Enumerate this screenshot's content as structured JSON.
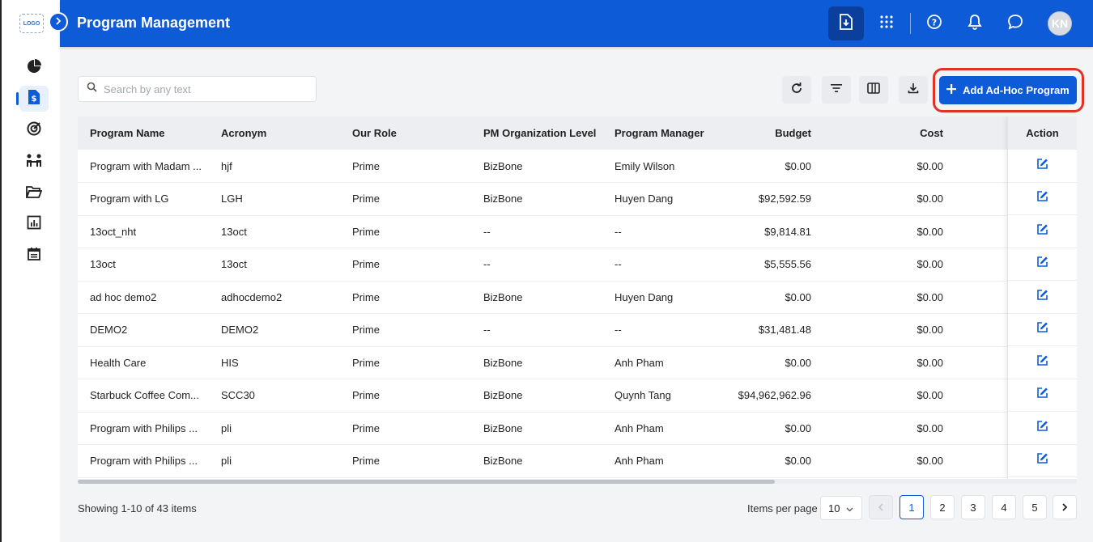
{
  "sidebar": {
    "logo_text": "LOGO",
    "items": [
      {
        "icon": "pie-chart-icon"
      },
      {
        "icon": "dollar-document-icon",
        "active": true
      },
      {
        "icon": "target-icon"
      },
      {
        "icon": "people-icon"
      },
      {
        "icon": "folder-open-icon"
      },
      {
        "icon": "bar-chart-icon"
      },
      {
        "icon": "calendar-icon"
      }
    ]
  },
  "header": {
    "title": "Program Management",
    "avatar_initials": "KN"
  },
  "search": {
    "placeholder": "Search by any text"
  },
  "toolbar": {
    "add_label": "Add Ad-Hoc Program"
  },
  "table": {
    "columns": [
      "Program Name",
      "Acronym",
      "Our Role",
      "PM Organization Level",
      "Program Manager",
      "Budget",
      "Cost"
    ],
    "action_header": "Action",
    "rows": [
      {
        "name": "Program with Madam ...",
        "acronym": "hjf",
        "role": "Prime",
        "level": "BizBone",
        "manager": "Emily Wilson",
        "budget": "$0.00",
        "cost": "$0.00"
      },
      {
        "name": "Program with LG",
        "acronym": "LGH",
        "role": "Prime",
        "level": "BizBone",
        "manager": "Huyen Dang",
        "budget": "$92,592.59",
        "cost": "$0.00"
      },
      {
        "name": "13oct_nht",
        "acronym": "13oct",
        "role": "Prime",
        "level": "--",
        "manager": "--",
        "budget": "$9,814.81",
        "cost": "$0.00"
      },
      {
        "name": "13oct",
        "acronym": "13oct",
        "role": "Prime",
        "level": "--",
        "manager": "--",
        "budget": "$5,555.56",
        "cost": "$0.00"
      },
      {
        "name": "ad hoc demo2",
        "acronym": "adhocdemo2",
        "role": "Prime",
        "level": "BizBone",
        "manager": "Huyen Dang",
        "budget": "$0.00",
        "cost": "$0.00"
      },
      {
        "name": "DEMO2",
        "acronym": "DEMO2",
        "role": "Prime",
        "level": "--",
        "manager": "--",
        "budget": "$31,481.48",
        "cost": "$0.00"
      },
      {
        "name": "Health Care",
        "acronym": "HIS",
        "role": "Prime",
        "level": "BizBone",
        "manager": "Anh Pham",
        "budget": "$0.00",
        "cost": "$0.00"
      },
      {
        "name": "Starbuck Coffee Com...",
        "acronym": "SCC30",
        "role": "Prime",
        "level": "BizBone",
        "manager": "Quynh Tang",
        "budget": "$94,962,962.96",
        "cost": "$0.00"
      },
      {
        "name": "Program with Philips ...",
        "acronym": "pli",
        "role": "Prime",
        "level": "BizBone",
        "manager": "Anh Pham",
        "budget": "$0.00",
        "cost": "$0.00"
      },
      {
        "name": "Program with Philips ...",
        "acronym": "pli",
        "role": "Prime",
        "level": "BizBone",
        "manager": "Anh Pham",
        "budget": "$0.00",
        "cost": "$0.00"
      }
    ]
  },
  "footer": {
    "showing": "Showing 1-10 of 43 items",
    "per_page_label": "Items per page",
    "per_page_value": "10",
    "pages": [
      "1",
      "2",
      "3",
      "4",
      "5"
    ],
    "current_page": "1"
  },
  "colors": {
    "primary": "#0d5bd7",
    "highlight": "#e53024"
  }
}
